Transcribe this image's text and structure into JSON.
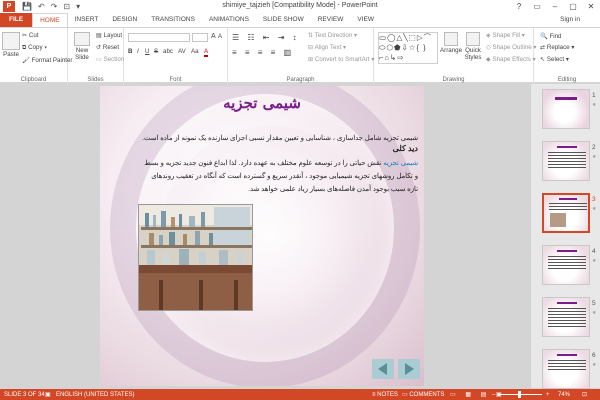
{
  "window": {
    "title": "shimiye_tajzieh [Compatibility Mode] - PowerPoint",
    "app_letter": "P",
    "controls": [
      "?",
      "▭",
      "–",
      "▢",
      "✕"
    ]
  },
  "qat": {
    "save": "💾",
    "undo": "↶",
    "redo": "↷",
    "start": "⊡",
    "customize": "▾"
  },
  "tabs": [
    "FILE",
    "HOME",
    "INSERT",
    "DESIGN",
    "TRANSITIONS",
    "ANIMATIONS",
    "SLIDE SHOW",
    "REVIEW",
    "VIEW"
  ],
  "active_tab": "HOME",
  "signin": "Sign in",
  "ribbon": {
    "clipboard": {
      "paste": "Paste",
      "cut": "Cut",
      "copy": "Copy",
      "format_painter": "Format Painter",
      "label": "Clipboard"
    },
    "slides": {
      "new_slide": "New",
      "new_slide2": "Slide",
      "layout": "Layout",
      "reset": "Reset",
      "section": "Section",
      "label": "Slides"
    },
    "font": {
      "label": "Font",
      "bold": "B",
      "italic": "I",
      "underline": "U",
      "strike": "S",
      "shadow": "abc",
      "spacing": "AV",
      "case": "Aa",
      "color": "A"
    },
    "paragraph": {
      "label": "Paragraph",
      "text_direction": "Text Direction",
      "align_text": "Align Text",
      "smartart": "Convert to SmartArt"
    },
    "drawing": {
      "label": "Drawing",
      "arrange": "Arrange",
      "quick_styles": "Quick",
      "quick_styles2": "Styles",
      "shape_fill": "Shape Fill",
      "shape_outline": "Shape Outline",
      "shape_effects": "Shape Effects"
    },
    "editing": {
      "label": "Editing",
      "find": "Find",
      "replace": "Replace",
      "select": "Select"
    }
  },
  "slide": {
    "title": "شیمی تجزیه",
    "para1": "شیمی تجزیه شامل جداسازی ، شناسایی و تعیین مقدار نسبی اجزای سازنده یک نمونه از ماده است.",
    "heading2": "دید کلی",
    "para2_highlight": "شیمی تجزیه",
    "para2": " نقش حیاتی را در توسعه علوم مختلف به عهده دارد. لذا ابداع فنون جدید تجزیه و بسط و تکامل روشهای تجزیه شیمیایی موجود ، آنقدر سریع و گسترده است که آنگاه در تعقیب روندهای تازه سبب بوجود آمدن فاصله‌های بسیار زیاد علمی خواهد شد."
  },
  "thumbnails": [
    "1",
    "2",
    "3",
    "4",
    "5",
    "6"
  ],
  "selected_slide": "3",
  "status": {
    "slide": "SLIDE 3 OF 34",
    "language": "ENGLISH (UNITED STATES)",
    "notes": "NOTES",
    "comments": "COMMENTS",
    "zoom": "74%"
  },
  "colors": {
    "accent": "#d24726",
    "title": "#7a1c8c"
  }
}
